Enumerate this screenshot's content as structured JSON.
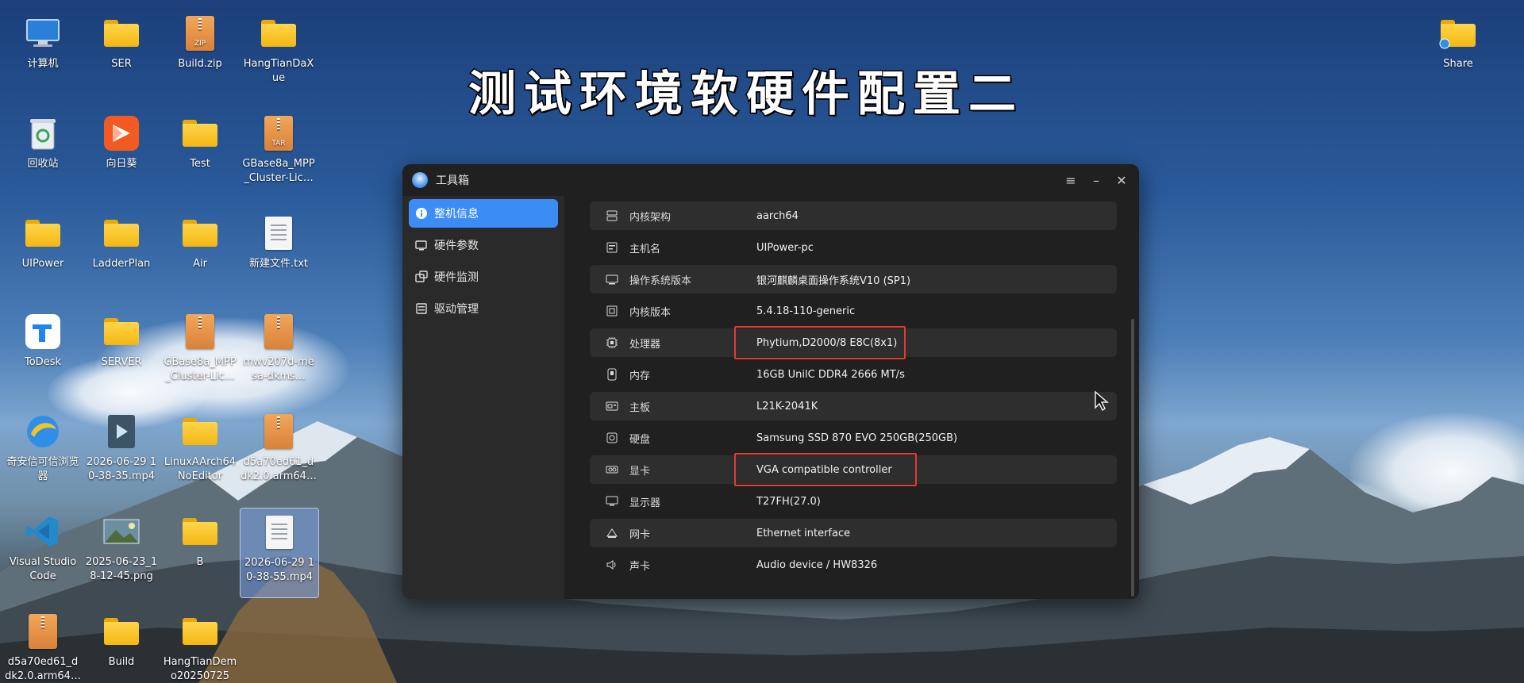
{
  "overlay_title": "测试环境软硬件配置二",
  "desktop_icons": [
    {
      "label": "计算机",
      "type": "computer"
    },
    {
      "label": "SER",
      "type": "folder"
    },
    {
      "label": "Build.zip",
      "type": "zip",
      "badge": "ZIP"
    },
    {
      "label": "HangTianDaXue",
      "type": "folder"
    },
    {
      "label": "回收站",
      "type": "trash"
    },
    {
      "label": "向日葵",
      "type": "sunlogin"
    },
    {
      "label": "Test",
      "type": "folder"
    },
    {
      "label": "GBase8a_MPP_Cluster-Lic…",
      "type": "zip",
      "badge": "TAR"
    },
    {
      "label": "UIPower",
      "type": "folder-home"
    },
    {
      "label": "LadderPlan",
      "type": "folder"
    },
    {
      "label": "Air",
      "type": "folder"
    },
    {
      "label": "新建文件.txt",
      "type": "doc"
    },
    {
      "label": "ToDesk",
      "type": "todesk"
    },
    {
      "label": "SERVER",
      "type": "folder"
    },
    {
      "label": "GBase8a_MPP_Cluster-Lic…",
      "type": "package"
    },
    {
      "label": "mwv207d-mesa-dkms…",
      "type": "package"
    },
    {
      "label": "奇安信可信浏览器",
      "type": "browser"
    },
    {
      "label": "2026-06-29 10-38-35.mp4",
      "type": "video"
    },
    {
      "label": "LinuxAArch64NoEditor",
      "type": "folder"
    },
    {
      "label": "d5a70ed61_ddk2.0.arm64…",
      "type": "package"
    },
    {
      "label": "Visual Studio Code",
      "type": "vscode"
    },
    {
      "label": "2025-06-23_18-12-45.png",
      "type": "image"
    },
    {
      "label": "B",
      "type": "folder"
    },
    {
      "label": "2026-06-29 10-38-55.mp4",
      "type": "doc"
    },
    {
      "label": "d5a70ed61_ddk2.0.arm64…",
      "type": "package"
    },
    {
      "label": "Build",
      "type": "folder"
    },
    {
      "label": "HangTianDemo20250725",
      "type": "folder"
    },
    {
      "label": "Share",
      "type": "folder-share"
    }
  ],
  "window": {
    "title": "工具箱",
    "controls": {
      "menu": "≡",
      "minimize": "–",
      "close": "✕"
    },
    "sidebar": [
      {
        "label": "整机信息",
        "icon": "info-icon",
        "active": true
      },
      {
        "label": "硬件参数",
        "icon": "monitor-icon",
        "active": false
      },
      {
        "label": "硬件监测",
        "icon": "monitor-check-icon",
        "active": false
      },
      {
        "label": "驱动管理",
        "icon": "driver-icon",
        "active": false
      }
    ],
    "rows": [
      {
        "label": "内核架构",
        "value": "aarch64",
        "icon": "architecture-icon"
      },
      {
        "label": "主机名",
        "value": "UIPower-pc",
        "icon": "hostname-icon"
      },
      {
        "label": "操作系统版本",
        "value": "银河麒麟桌面操作系统V10 (SP1)",
        "icon": "os-icon"
      },
      {
        "label": "内核版本",
        "value": "5.4.18-110-generic",
        "icon": "kernel-icon"
      },
      {
        "label": "处理器",
        "value": "Phytium,D2000/8 E8C(8x1)",
        "icon": "cpu-icon"
      },
      {
        "label": "内存",
        "value": "16GB UnilC DDR4 2666 MT/s",
        "icon": "memory-icon"
      },
      {
        "label": "主板",
        "value": "L21K-2041K",
        "icon": "motherboard-icon"
      },
      {
        "label": "硬盘",
        "value": "Samsung SSD 870 EVO 250GB(250GB)",
        "icon": "disk-icon"
      },
      {
        "label": "显卡",
        "value": "VGA compatible controller",
        "icon": "gpu-icon"
      },
      {
        "label": "显示器",
        "value": "T27FH(27.0)",
        "icon": "display-icon"
      },
      {
        "label": "网卡",
        "value": "Ethernet interface",
        "icon": "network-icon"
      },
      {
        "label": "声卡",
        "value": "Audio device / HW8326",
        "icon": "sound-icon"
      }
    ],
    "highlighted_rows": [
      "处理器",
      "显卡"
    ]
  },
  "colors": {
    "accent": "#3b8df5",
    "highlight": "#e53935",
    "window_bg": "#202020"
  }
}
